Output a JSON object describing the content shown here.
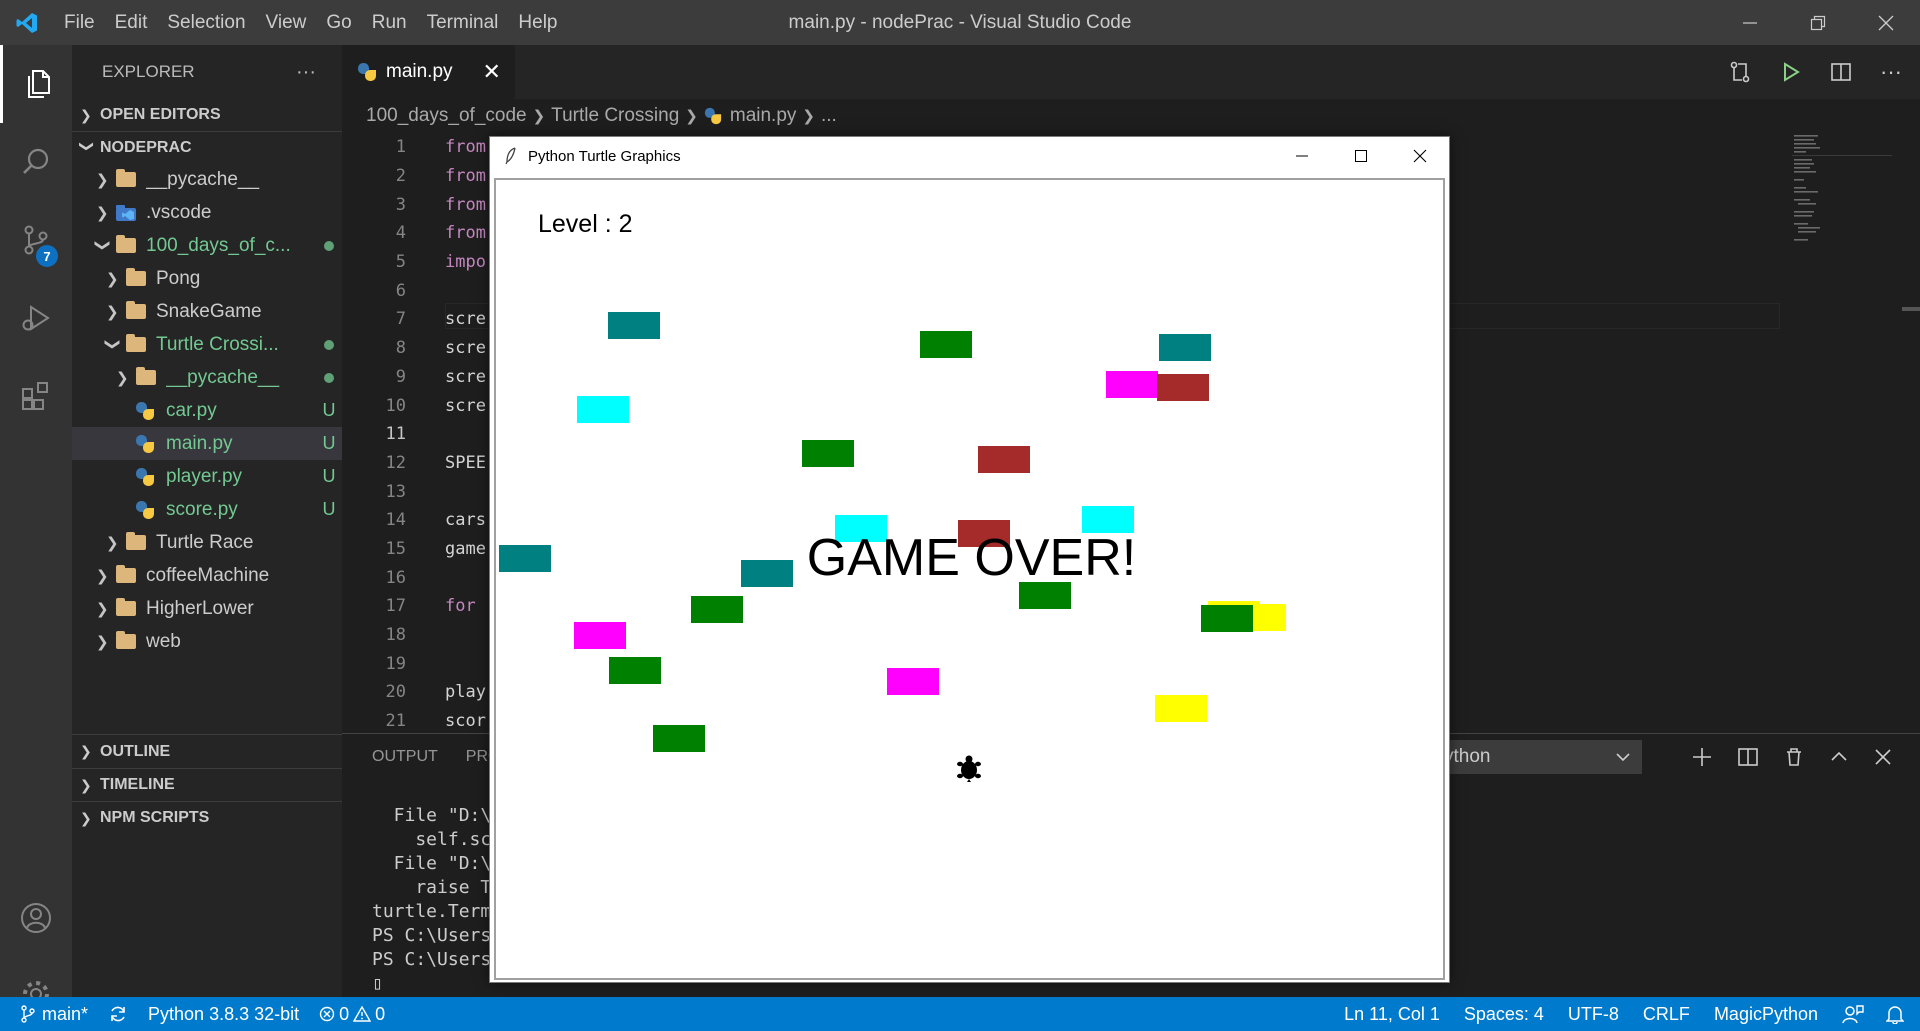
{
  "titlebar": {
    "menu": [
      "File",
      "Edit",
      "Selection",
      "View",
      "Go",
      "Run",
      "Terminal",
      "Help"
    ],
    "title": "main.py - nodePrac - Visual Studio Code"
  },
  "activitybar": {
    "scm_badge": "7"
  },
  "sidebar": {
    "header": "EXPLORER",
    "more": "···",
    "open_editors": "OPEN EDITORS",
    "root": "NODEPRAC",
    "tree": [
      {
        "name": "__pycache__",
        "indent": 0,
        "kind": "folder",
        "open": false,
        "decoration": "",
        "color": "#cccccc"
      },
      {
        "name": ".vscode",
        "indent": 0,
        "kind": "vscode",
        "open": false,
        "decoration": "",
        "color": "#cccccc"
      },
      {
        "name": "100_days_of_c...",
        "indent": 0,
        "kind": "folder",
        "open": true,
        "decoration": "dot",
        "color": "#73c991"
      },
      {
        "name": "Pong",
        "indent": 1,
        "kind": "folder",
        "open": false,
        "decoration": "",
        "color": "#cccccc"
      },
      {
        "name": "SnakeGame",
        "indent": 1,
        "kind": "folder",
        "open": false,
        "decoration": "",
        "color": "#cccccc"
      },
      {
        "name": "Turtle Crossi...",
        "indent": 1,
        "kind": "folder",
        "open": true,
        "decoration": "dot",
        "color": "#73c991"
      },
      {
        "name": "__pycache__",
        "indent": 2,
        "kind": "folder",
        "open": false,
        "decoration": "dot",
        "color": "#73c991"
      },
      {
        "name": "car.py",
        "indent": 2,
        "kind": "py",
        "decoration": "U",
        "color": "#73c991"
      },
      {
        "name": "main.py",
        "indent": 2,
        "kind": "py",
        "decoration": "U",
        "color": "#73c991",
        "selected": true
      },
      {
        "name": "player.py",
        "indent": 2,
        "kind": "py",
        "decoration": "U",
        "color": "#73c991"
      },
      {
        "name": "score.py",
        "indent": 2,
        "kind": "py",
        "decoration": "U",
        "color": "#73c991"
      },
      {
        "name": "Turtle Race",
        "indent": 1,
        "kind": "folder",
        "open": false,
        "decoration": "",
        "color": "#cccccc"
      },
      {
        "name": "coffeeMachine",
        "indent": 0,
        "kind": "folder",
        "open": false,
        "decoration": "",
        "color": "#cccccc"
      },
      {
        "name": "HigherLower",
        "indent": 0,
        "kind": "folder",
        "open": false,
        "decoration": "",
        "color": "#cccccc"
      },
      {
        "name": "web",
        "indent": 0,
        "kind": "folder",
        "open": false,
        "decoration": "",
        "color": "#cccccc"
      }
    ],
    "outline": "OUTLINE",
    "timeline": "TIMELINE",
    "npm_scripts": "NPM SCRIPTS"
  },
  "editor": {
    "tab": "main.py",
    "breadcrumb": [
      "100_days_of_code",
      "Turtle Crossing",
      "main.py",
      "..."
    ],
    "lines": [
      {
        "n": "1",
        "text": "from",
        "kw": true
      },
      {
        "n": "2",
        "text": "from",
        "kw": true
      },
      {
        "n": "3",
        "text": "from",
        "kw": true
      },
      {
        "n": "4",
        "text": "from",
        "kw": true
      },
      {
        "n": "5",
        "text": "impo",
        "kw": true
      },
      {
        "n": "6",
        "text": ""
      },
      {
        "n": "7",
        "text": "scre"
      },
      {
        "n": "8",
        "text": "scre"
      },
      {
        "n": "9",
        "text": "scre"
      },
      {
        "n": "10",
        "text": "scre"
      },
      {
        "n": "11",
        "text": "",
        "current": true
      },
      {
        "n": "12",
        "text": "SPEE"
      },
      {
        "n": "13",
        "text": ""
      },
      {
        "n": "14",
        "text": "cars"
      },
      {
        "n": "15",
        "text": "game"
      },
      {
        "n": "16",
        "text": ""
      },
      {
        "n": "17",
        "text": "for",
        "kw": true
      },
      {
        "n": "18",
        "text": ""
      },
      {
        "n": "19",
        "text": ""
      },
      {
        "n": "20",
        "text": "play"
      },
      {
        "n": "21",
        "text": "scor"
      }
    ]
  },
  "panel": {
    "tabs": [
      "OUTPUT",
      "PRO"
    ],
    "terminal_select": "ython",
    "terminal_lines": [
      "  File \"D:\\",
      "    self.sc",
      "  File \"D:\\",
      "    raise T",
      "turtle.Term",
      "PS C:\\Users",
      "PS C:\\Users",
      "▯"
    ]
  },
  "statusbar": {
    "branch": "main*",
    "python": "Python 3.8.3 32-bit",
    "errors": "0",
    "warnings": "0",
    "position": "Ln 11, Col 1",
    "spaces": "Spaces: 4",
    "encoding": "UTF-8",
    "eol": "CRLF",
    "language": "MagicPython"
  },
  "turtle_window": {
    "title": "Python Turtle Graphics",
    "level": "Level : 2",
    "game_over": "GAME OVER!",
    "car_colors": {
      "teal": "#008080",
      "green": "#008000",
      "magenta": "#ff00ff",
      "cyan": "#00ffff",
      "brown": "#a52a2a",
      "yellow": "#ffff00"
    }
  }
}
